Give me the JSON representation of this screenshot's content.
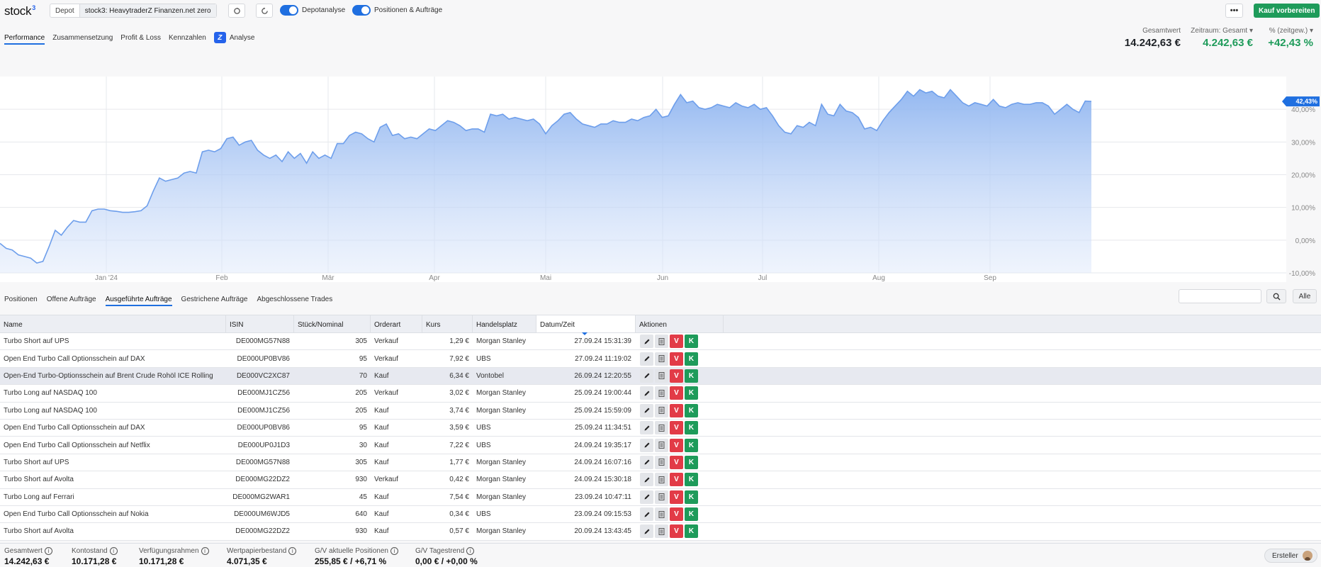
{
  "header": {
    "logo": "stock",
    "logo_sup": "3",
    "depot_label": "Depot",
    "depot_value": "stock3: HeavytraderZ Finanzen.net zero",
    "toggle_depotanalyse": "Depotanalyse",
    "toggle_positionen": "Positionen & Aufträge",
    "more_label": "•••",
    "kauf_label": "Kauf vorbereiten"
  },
  "subnav": {
    "items": [
      "Performance",
      "Zusammensetzung",
      "Profit & Loss",
      "Kennzahlen"
    ],
    "analyse_label": "Analyse"
  },
  "summary": {
    "gesamtwert_label": "Gesamtwert",
    "gesamtwert_value": "14.242,63 €",
    "zeitraum_label": "Zeitraum: Gesamt",
    "zeitraum_value": "4.242,63 €",
    "pct_label": "% (zeitgew.)",
    "pct_value": "+42,43 %"
  },
  "chart_data": {
    "type": "area",
    "x_labels": [
      "Jan '24",
      "Feb",
      "Mär",
      "Apr",
      "Mai",
      "Jun",
      "Jul",
      "Aug",
      "Sep"
    ],
    "y_ticks": [
      "40,00%",
      "30,00%",
      "20,00%",
      "10,00%",
      "0,00%",
      "-10,00%"
    ],
    "ylim": [
      -10,
      50
    ],
    "current_value_label": "42,43%",
    "color": "#6d9eeb",
    "values": [
      -1,
      -2.5,
      -3,
      -4.5,
      -5,
      -5.5,
      -7,
      -6.5,
      -2,
      3,
      1.5,
      4,
      6,
      5.5,
      5.5,
      9,
      9.5,
      9.5,
      9,
      8.8,
      8.5,
      8.5,
      8.7,
      9,
      10.5,
      15,
      19,
      18,
      18.5,
      19,
      20.5,
      21,
      20.5,
      27,
      27.5,
      27,
      28,
      31,
      31.5,
      29,
      30,
      30.5,
      27.5,
      26,
      25,
      26,
      24,
      27,
      25,
      26.5,
      23.5,
      27,
      25,
      26,
      25,
      29.5,
      29.5,
      32,
      33,
      32.5,
      31,
      30,
      34.5,
      35.5,
      32,
      32.5,
      31,
      31.5,
      31,
      32.5,
      34,
      33.5,
      35,
      36.5,
      36,
      35,
      33.5,
      34,
      34,
      33,
      38.5,
      38,
      38.5,
      37,
      37.5,
      37,
      36.5,
      37,
      35.5,
      32.5,
      35,
      36.5,
      38.5,
      39,
      37,
      35.5,
      35,
      34.5,
      35.5,
      35.5,
      36.5,
      36,
      36,
      37,
      36.5,
      37.5,
      38,
      40,
      37.5,
      38,
      41.5,
      44.5,
      42,
      42.5,
      40.5,
      40,
      40.5,
      41.5,
      41,
      40.5,
      42,
      41,
      40.5,
      41.5,
      40,
      40.5,
      38,
      35,
      33,
      32.5,
      35,
      34.5,
      36,
      35,
      41.5,
      38.5,
      38,
      41.5,
      39.5,
      39,
      37.5,
      34,
      34.5,
      33.5,
      36.5,
      39,
      41,
      43,
      45.5,
      44,
      46,
      45,
      45.5,
      44,
      43.5,
      46,
      44,
      42,
      41,
      42,
      41.5,
      41,
      43,
      41,
      40.5,
      41.5,
      42,
      41.5,
      41.5,
      42,
      42,
      41,
      38.5,
      40,
      41.5,
      40,
      39,
      42.5,
      42.4
    ]
  },
  "tabs": [
    "Positionen",
    "Offene Aufträge",
    "Ausgeführte Aufträge",
    "Gestrichene Aufträge",
    "Abgeschlossene Trades"
  ],
  "search_icon": "search-icon",
  "alle_label": "Alle",
  "table": {
    "headers": [
      "Name",
      "ISIN",
      "Stück/Nominal",
      "Orderart",
      "Kurs",
      "Handelsplatz",
      "Datum/Zeit",
      "Aktionen"
    ],
    "rows": [
      {
        "name": "Turbo Short auf UPS",
        "isin": "DE000MG57N88",
        "stueck": "305",
        "orderart": "Verkauf",
        "kurs": "1,29 €",
        "platz": "Morgan Stanley",
        "datum": "27.09.24 15:31:39"
      },
      {
        "name": "Open End Turbo Call Optionsschein auf DAX",
        "isin": "DE000UP0BV86",
        "stueck": "95",
        "orderart": "Verkauf",
        "kurs": "7,92 €",
        "platz": "UBS",
        "datum": "27.09.24 11:19:02"
      },
      {
        "name": "Open-End Turbo-Optionsschein auf Brent Crude Rohöl ICE Rolling",
        "isin": "DE000VC2XC87",
        "stueck": "70",
        "orderart": "Kauf",
        "kurs": "6,34 €",
        "platz": "Vontobel",
        "datum": "26.09.24 12:20:55"
      },
      {
        "name": "Turbo Long auf NASDAQ 100",
        "isin": "DE000MJ1CZ56",
        "stueck": "205",
        "orderart": "Verkauf",
        "kurs": "3,02 €",
        "platz": "Morgan Stanley",
        "datum": "25.09.24 19:00:44"
      },
      {
        "name": "Turbo Long auf NASDAQ 100",
        "isin": "DE000MJ1CZ56",
        "stueck": "205",
        "orderart": "Kauf",
        "kurs": "3,74 €",
        "platz": "Morgan Stanley",
        "datum": "25.09.24 15:59:09"
      },
      {
        "name": "Open End Turbo Call Optionsschein auf DAX",
        "isin": "DE000UP0BV86",
        "stueck": "95",
        "orderart": "Kauf",
        "kurs": "3,59 €",
        "platz": "UBS",
        "datum": "25.09.24 11:34:51"
      },
      {
        "name": "Open End Turbo Call Optionsschein auf Netflix",
        "isin": "DE000UP0J1D3",
        "stueck": "30",
        "orderart": "Kauf",
        "kurs": "7,22 €",
        "platz": "UBS",
        "datum": "24.09.24 19:35:17"
      },
      {
        "name": "Turbo Short auf UPS",
        "isin": "DE000MG57N88",
        "stueck": "305",
        "orderart": "Kauf",
        "kurs": "1,77 €",
        "platz": "Morgan Stanley",
        "datum": "24.09.24 16:07:16"
      },
      {
        "name": "Turbo Short auf Avolta",
        "isin": "DE000MG22DZ2",
        "stueck": "930",
        "orderart": "Verkauf",
        "kurs": "0,42 €",
        "platz": "Morgan Stanley",
        "datum": "24.09.24 15:30:18"
      },
      {
        "name": "Turbo Long auf Ferrari",
        "isin": "DE000MG2WAR1",
        "stueck": "45",
        "orderart": "Kauf",
        "kurs": "7,54 €",
        "platz": "Morgan Stanley",
        "datum": "23.09.24 10:47:11"
      },
      {
        "name": "Open End Turbo Call Optionsschein auf Nokia",
        "isin": "DE000UM6WJD5",
        "stueck": "640",
        "orderart": "Kauf",
        "kurs": "0,34 €",
        "platz": "UBS",
        "datum": "23.09.24 09:15:53"
      },
      {
        "name": "Turbo Short auf Avolta",
        "isin": "DE000MG22DZ2",
        "stueck": "930",
        "orderart": "Kauf",
        "kurs": "0,57 €",
        "platz": "Morgan Stanley",
        "datum": "20.09.24 13:43:45"
      }
    ],
    "action_labels": {
      "v": "V",
      "k": "K"
    }
  },
  "footer": {
    "gesamtwert_label": "Gesamtwert",
    "gesamtwert_value": "14.242,63 €",
    "kontostand_label": "Kontostand",
    "kontostand_value": "10.171,28 €",
    "verfuegung_label": "Verfügungsrahmen",
    "verfuegung_value": "10.171,28 €",
    "wertpapier_label": "Wertpapierbestand",
    "wertpapier_value": "4.071,35 €",
    "gv_akt_label": "G/V aktuelle Positionen",
    "gv_akt_abs": "255,85 €",
    "gv_akt_pct": "+6,71 %",
    "gv_tag_label": "G/V Tagestrend",
    "gv_tag_abs": "0,00 €",
    "gv_tag_pct": "+0,00 %",
    "ersteller_label": "Ersteller"
  }
}
